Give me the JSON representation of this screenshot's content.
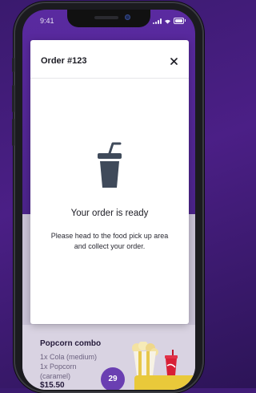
{
  "status_bar": {
    "time": "9:41"
  },
  "modal": {
    "title": "Order #123",
    "close_label": "×",
    "heading": "Your order is ready",
    "message": "Please head to the food pick up area and collect your order."
  },
  "background_item": {
    "name": "Popcorn combo",
    "lines": [
      "1x Cola (medium)",
      "1x Popcorn",
      "(caramel)"
    ],
    "price": "$15.50",
    "badge": "29"
  },
  "colors": {
    "background": "#3a1a6e",
    "icon": "#3f4a5a",
    "badge": "#6a3fb2",
    "button": "#e9c93a"
  },
  "icons": [
    "drink-cup-icon",
    "close-icon",
    "signal-icon",
    "wifi-icon",
    "battery-icon"
  ]
}
